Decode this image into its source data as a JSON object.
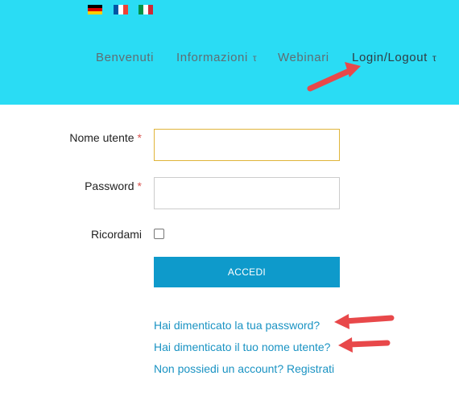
{
  "colors": {
    "header_bg": "#2adcf4",
    "button_bg": "#0e9acb",
    "link": "#1a93c3",
    "annotation_arrow": "#e8484a",
    "focus_border": "#e0b53a"
  },
  "languages": [
    {
      "code": "de",
      "icon": "german-flag-icon"
    },
    {
      "code": "fr",
      "icon": "french-flag-icon"
    },
    {
      "code": "it",
      "icon": "italian-flag-icon"
    }
  ],
  "nav": {
    "items": [
      {
        "label": "Benvenuti",
        "caret": ""
      },
      {
        "label": "Informazioni",
        "caret": "τ"
      },
      {
        "label": "Webinari",
        "caret": ""
      },
      {
        "label": "Login/Logout",
        "caret": "τ"
      }
    ]
  },
  "form": {
    "username_label": "Nome utente",
    "password_label": "Password",
    "required_mark": "*",
    "remember_label": "Ricordami",
    "username_value": "",
    "password_value": "",
    "remember_checked": false,
    "submit_label": "ACCEDI"
  },
  "links": {
    "forgot_password": "Hai dimenticato la tua password?",
    "forgot_username": "Hai dimenticato il tuo nome utente?",
    "register": "Non possiedi un account? Registrati"
  }
}
